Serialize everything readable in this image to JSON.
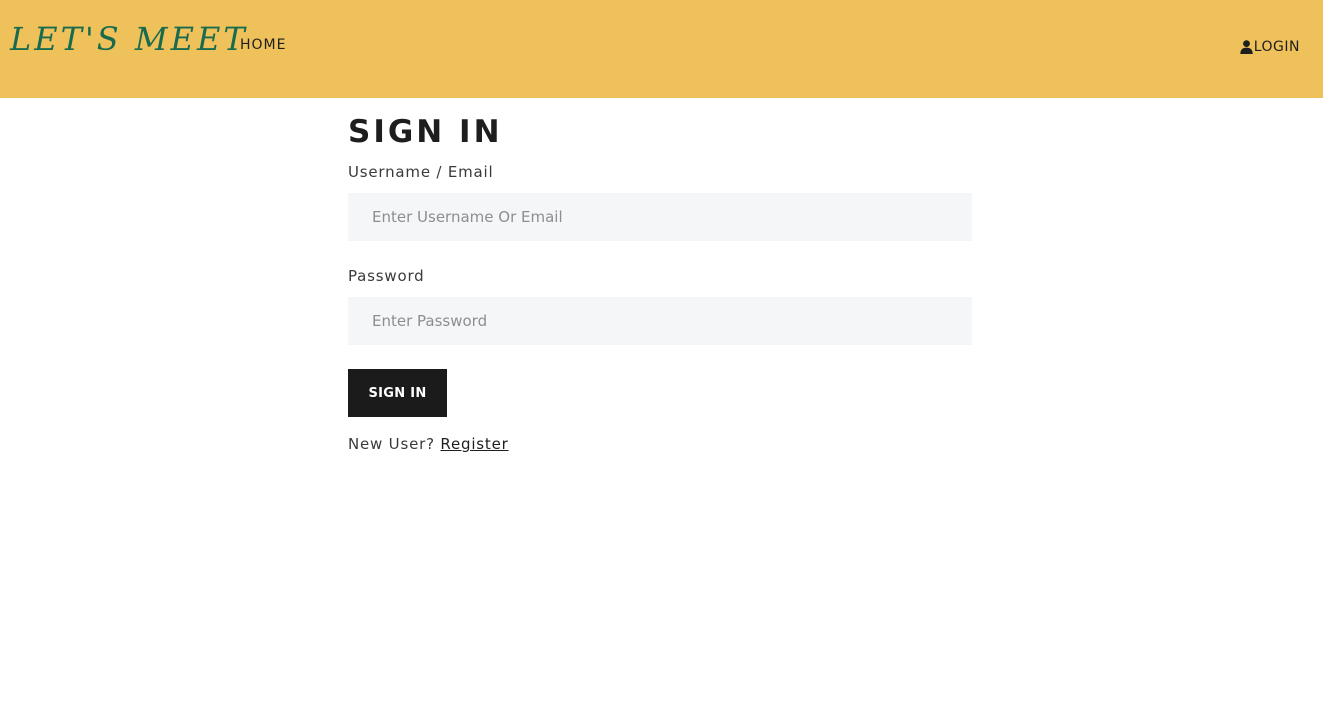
{
  "header": {
    "brand": "LET'S MEET",
    "nav_home": "HOME",
    "nav_login": "LOGIN",
    "login_icon": "user-icon"
  },
  "form": {
    "title": "SIGN IN",
    "username_label": "Username / Email",
    "username_placeholder": "Enter Username Or Email",
    "username_value": "",
    "password_label": "Password",
    "password_placeholder": "Enter Password",
    "password_value": "",
    "submit_label": "SIGN IN",
    "new_user_text": "New User?",
    "register_link": "Register"
  },
  "colors": {
    "navbar_bg": "#efc15b",
    "brand": "#1a6b4e",
    "button_bg": "#1b1b1b",
    "input_bg": "#f5f6f7"
  }
}
